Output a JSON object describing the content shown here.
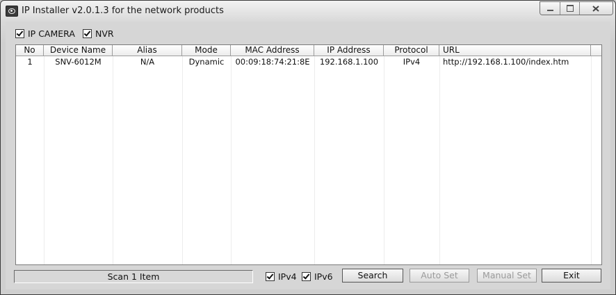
{
  "window": {
    "title": "IP Installer v2.0.1.3 for the network products"
  },
  "filters": {
    "ip_camera": "IP CAMERA",
    "nvr": "NVR"
  },
  "table": {
    "columns": [
      "No",
      "Device Name",
      "Alias",
      "Mode",
      "MAC Address",
      "IP Address",
      "Protocol",
      "URL"
    ],
    "rows": [
      [
        "1",
        "SNV-6012M",
        "N/A",
        "Dynamic",
        "00:09:18:74:21:8E",
        "192.168.1.100",
        "IPv4",
        "http://192.168.1.100/index.htm"
      ]
    ]
  },
  "footer": {
    "status": "Scan 1 Item",
    "ipv4": "IPv4",
    "ipv6": "IPv6",
    "search": "Search",
    "auto_set": "Auto Set",
    "manual_set": "Manual Set",
    "exit": "Exit"
  }
}
